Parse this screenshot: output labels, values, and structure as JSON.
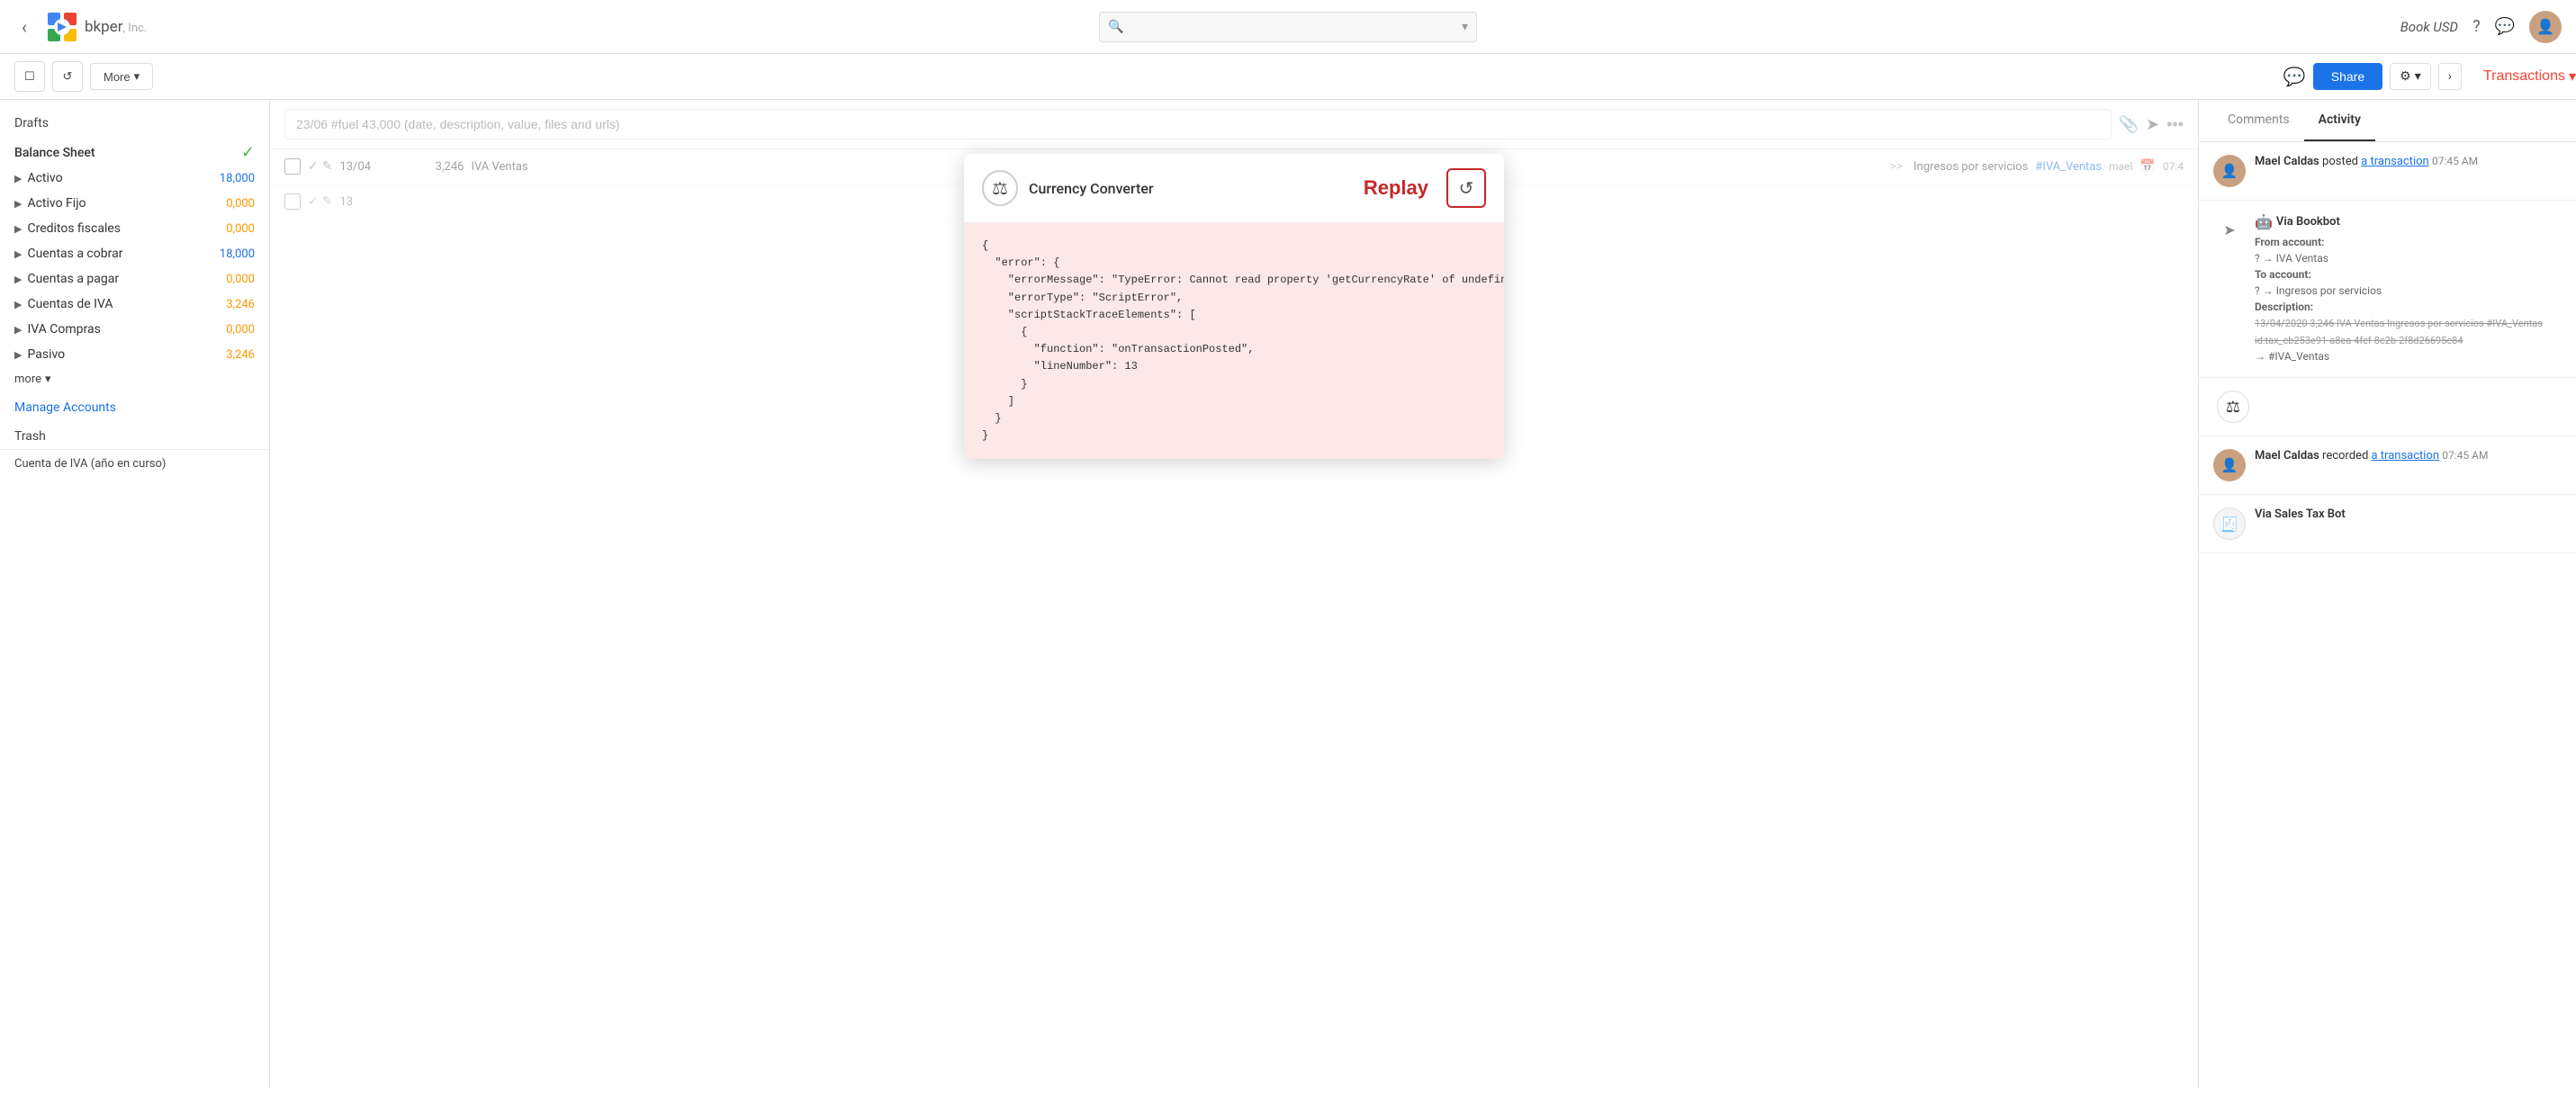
{
  "header": {
    "back_label": "‹",
    "logo_text": "bkper",
    "logo_subtitle": ", Inc.",
    "search_placeholder": "",
    "book_name": "Book USD",
    "help_icon": "?",
    "chat_icon": "💬"
  },
  "toolbar": {
    "transactions_label": "Transactions",
    "transactions_caret": "▾",
    "checkbox_icon": "☐",
    "refresh_icon": "↺",
    "more_label": "More",
    "more_caret": "▾",
    "share_label": "Share",
    "settings_icon": "⚙",
    "settings_caret": "▾",
    "expand_icon": "›"
  },
  "transaction_input": {
    "placeholder": "23/06 #fuel 43,000 (date, description, value, files and urls)",
    "attach_icon": "📎",
    "send_icon": "➤",
    "more_icon": "•••"
  },
  "sidebar": {
    "drafts_label": "Drafts",
    "balance_sheet_label": "Balance Sheet",
    "items": [
      {
        "name": "Activo",
        "value": "18,000",
        "color": "blue"
      },
      {
        "name": "Activo Fijo",
        "value": "0,000",
        "color": "orange"
      },
      {
        "name": "Creditos fiscales",
        "value": "0,000",
        "color": "orange"
      },
      {
        "name": "Cuentas a cobrar",
        "value": "18,000",
        "color": "blue"
      },
      {
        "name": "Cuentas a pagar",
        "value": "0,000",
        "color": "orange"
      },
      {
        "name": "Cuentas de IVA",
        "value": "3,246",
        "color": "orange"
      },
      {
        "name": "IVA Compras",
        "value": "0,000",
        "color": "orange"
      },
      {
        "name": "Pasivo",
        "value": "3,246",
        "color": "orange"
      }
    ],
    "more_label": "more",
    "manage_accounts_label": "Manage Accounts",
    "trash_label": "Trash",
    "cuenta_label": "Cuenta de IVA (año en curso)"
  },
  "transaction": {
    "date": "13/04",
    "amount": "3,246",
    "description": "IVA Ventas",
    "arrow": ">>",
    "to_account": "Ingresos por servicios",
    "tag": "#IVA_Ventas",
    "user": "mael",
    "time": "07:4"
  },
  "modal": {
    "title": "Currency Converter",
    "icon": "⚖",
    "replay_label": "Replay",
    "replay_icon": "↺",
    "error_json": "{\n  \"error\": {\n    \"errorMessage\": \"TypeError: Cannot read property 'getCurrencyRate' of undefined\",\n    \"errorType\": \"ScriptError\",\n    \"scriptStackTraceElements\": [\n      {\n        \"function\": \"onTransactionPosted\",\n        \"lineNumber\": 13\n      }\n    ]\n  }\n}"
  },
  "right_panel": {
    "tabs": [
      {
        "label": "Comments",
        "active": false
      },
      {
        "label": "Activity",
        "active": true
      }
    ],
    "activities": [
      {
        "type": "user",
        "user": "Mael Caldas",
        "action": "posted",
        "link": "a transaction",
        "time": "07:45 AM",
        "avatar": "👤"
      },
      {
        "type": "bot",
        "name": "Via Bookbot",
        "icon": "🤖",
        "detail_from_label": "From account:",
        "detail_from": "? → IVA Ventas",
        "detail_to_label": "To account:",
        "detail_to": "? → Ingresos por servicios",
        "detail_desc_label": "Description:",
        "detail_strikethrough": "13/04/2020 3,246 IVA Ventas Ingresos por servicios #IVA_Ventas id:tax_cb253e91-a8ea-4fcf-8c2b-2f8d26695c84",
        "detail_arrow": "→",
        "detail_tag": "#IVA_Ventas"
      },
      {
        "type": "user",
        "user": "Mael Caldas",
        "action": "recorded",
        "link": "a transaction",
        "time": "07:45 AM",
        "avatar": "👤"
      },
      {
        "type": "bot",
        "name": "Via Sales Tax Bot",
        "icon": "🧾"
      }
    ]
  }
}
